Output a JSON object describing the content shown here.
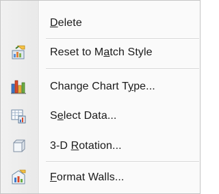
{
  "menu": {
    "items": [
      {
        "pre": "",
        "key": "D",
        "post": "elete",
        "icon": "none",
        "interactable": true
      },
      {
        "pre": "Reset to M",
        "key": "a",
        "post": "tch Style",
        "icon": "reset-style-icon"
      },
      {
        "pre": "Change Chart T",
        "key": "y",
        "post": "pe...",
        "icon": "change-chart-type-icon"
      },
      {
        "pre": "S",
        "key": "e",
        "post": "lect Data...",
        "icon": "select-data-icon"
      },
      {
        "pre": "3-D ",
        "key": "R",
        "post": "otation...",
        "icon": "3d-rotation-icon"
      },
      {
        "pre": "",
        "key": "F",
        "post": "ormat Walls...",
        "icon": "format-walls-icon"
      }
    ]
  }
}
